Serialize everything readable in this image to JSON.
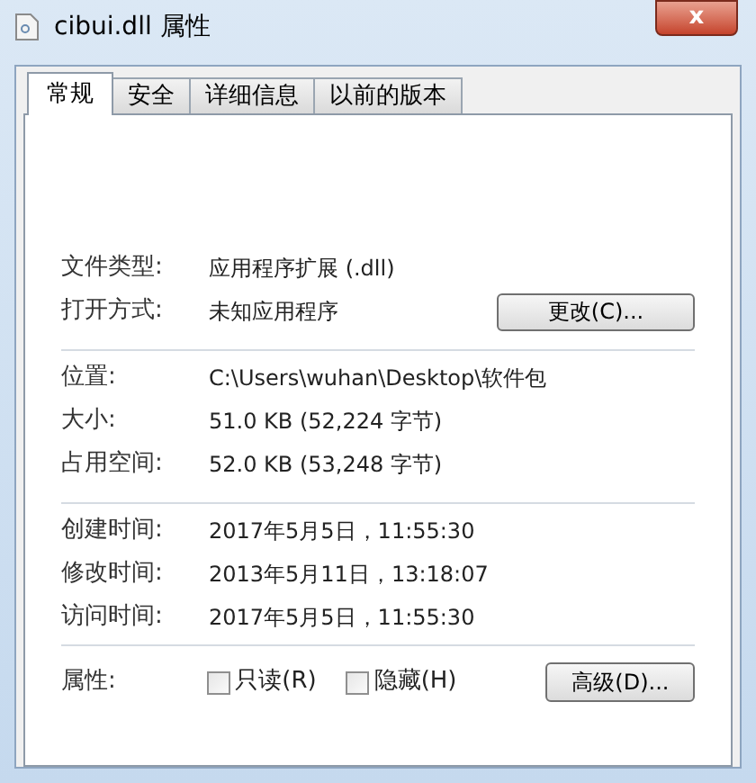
{
  "window": {
    "title": "cibui.dll 属性",
    "close": "x"
  },
  "tabs": [
    {
      "label": "常规",
      "selected": true
    },
    {
      "label": "安全",
      "selected": false
    },
    {
      "label": "详细信息",
      "selected": false
    },
    {
      "label": "以前的版本",
      "selected": false
    }
  ],
  "sections": [
    {
      "rows": [
        {
          "label": "文件类型:",
          "value": "应用程序扩展 (.dll)"
        },
        {
          "label": "打开方式:",
          "value": "未知应用程序",
          "button": "更改(C)..."
        }
      ]
    },
    {
      "rows": [
        {
          "label": "位置:",
          "value": "C:\\Users\\wuhan\\Desktop\\软件包"
        },
        {
          "label": "大小:",
          "value": "51.0 KB (52,224 字节)"
        },
        {
          "label": "占用空间:",
          "value": "52.0 KB (53,248 字节)"
        }
      ]
    },
    {
      "rows": [
        {
          "label": "创建时间:",
          "value": "2017年5月5日，11:55:30"
        },
        {
          "label": "修改时间:",
          "value": "2013年5月11日，13:18:07"
        },
        {
          "label": "访问时间:",
          "value": "2017年5月5日，11:55:30"
        }
      ]
    }
  ],
  "attributes": {
    "label": "属性:",
    "checkboxes": [
      {
        "label": "只读(R)",
        "checked": false
      },
      {
        "label": "隐藏(H)",
        "checked": false
      }
    ],
    "button": "高级(D)..."
  }
}
